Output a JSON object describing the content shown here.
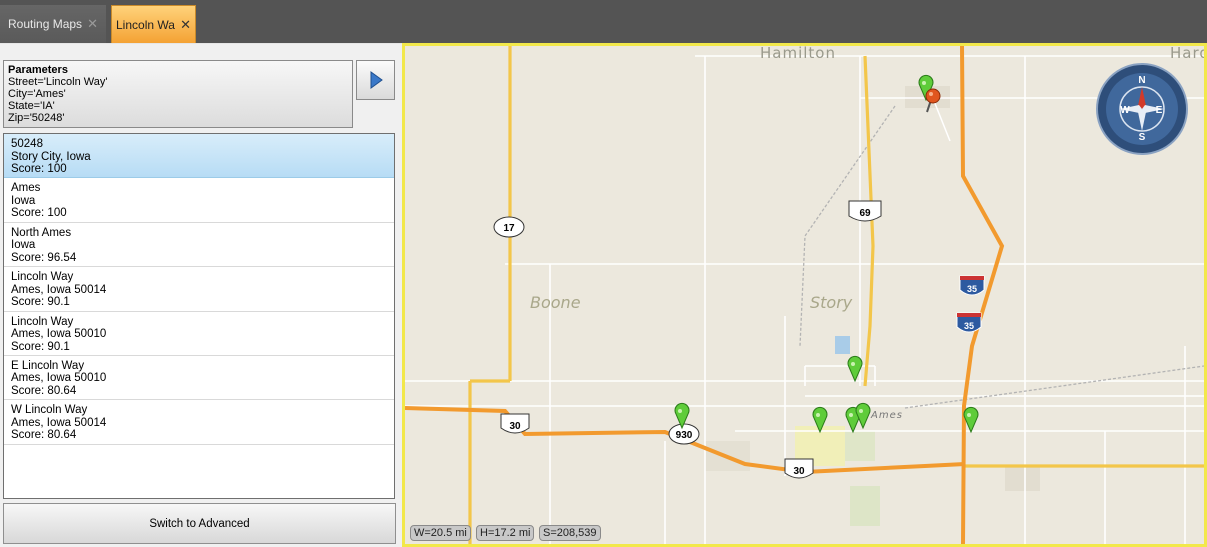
{
  "tabs": [
    {
      "label": "Routing Maps",
      "close": "✕"
    },
    {
      "label": "Lincoln Wa",
      "close": "✕"
    }
  ],
  "parameters": {
    "title": "Parameters",
    "lines": [
      "Street='Lincoln Way'",
      "City='Ames'",
      "State='IA'",
      "Zip='50248'"
    ]
  },
  "results": [
    {
      "line1": "50248",
      "line2": "Story City, Iowa",
      "score": "Score:  100"
    },
    {
      "line1": "Ames",
      "line2": "Iowa",
      "score": "Score:  100"
    },
    {
      "line1": "North Ames",
      "line2": "Iowa",
      "score": "Score:  96.54"
    },
    {
      "line1": "Lincoln Way",
      "line2": "Ames, Iowa  50014",
      "score": "Score:  90.1"
    },
    {
      "line1": "Lincoln Way",
      "line2": "Ames, Iowa  50010",
      "score": "Score:  90.1"
    },
    {
      "line1": "E Lincoln Way",
      "line2": "Ames, Iowa  50010",
      "score": "Score:  80.64"
    },
    {
      "line1": "W Lincoln Way",
      "line2": "Ames, Iowa  50014",
      "score": "Score:  80.64"
    }
  ],
  "switch_label": "Switch to Advanced",
  "map": {
    "places": {
      "hamilton": "Hamilton",
      "hardin": "Hard",
      "boone": "Boone",
      "story": "Story",
      "ames": "Ames"
    },
    "shields": {
      "r17": "17",
      "r69": "69",
      "i35a": "35",
      "i35b": "35",
      "r30a": "30",
      "r930": "930",
      "r30b": "30"
    },
    "compass": {
      "n": "N",
      "e": "E",
      "s": "S",
      "w": "W"
    },
    "status": {
      "width": "W=20.5 mi",
      "height": "H=17.2 mi",
      "scale": "S=208,539"
    }
  },
  "colors": {
    "highway": "#f29a2e",
    "minor_highway": "#f3c64a",
    "map_bg": "#ece8dd",
    "active_tab": "#f4a234",
    "selected_row": "#b7dcf5",
    "map_border": "#f2e84a"
  }
}
